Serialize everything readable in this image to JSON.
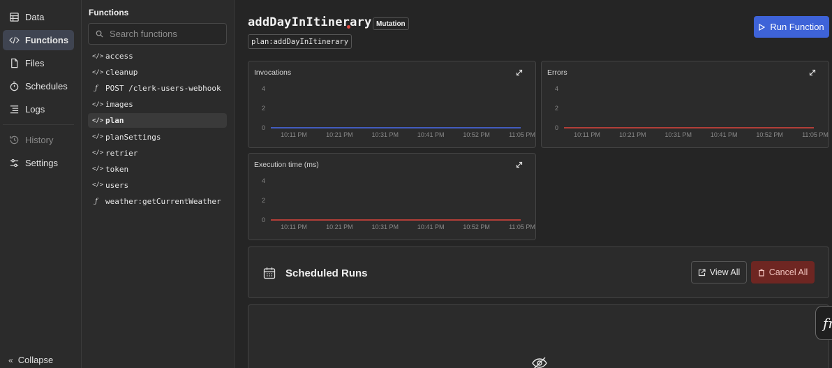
{
  "nav": {
    "items": [
      {
        "label": "Data",
        "icon": "table-icon"
      },
      {
        "label": "Functions",
        "icon": "code-icon",
        "active": true
      },
      {
        "label": "Files",
        "icon": "file-icon"
      },
      {
        "label": "Schedules",
        "icon": "stopwatch-icon"
      },
      {
        "label": "Logs",
        "icon": "list-icon"
      },
      {
        "label": "History",
        "icon": "history-icon",
        "disabled": true
      },
      {
        "label": "Settings",
        "icon": "sliders-icon"
      }
    ],
    "collapse_label": "Collapse"
  },
  "functions_panel": {
    "title": "Functions",
    "search_placeholder": "Search functions",
    "items": [
      {
        "label": "access",
        "icon": "code-icon"
      },
      {
        "label": "cleanup",
        "icon": "code-icon"
      },
      {
        "label": "POST /clerk-users-webhook",
        "icon": "fn-icon"
      },
      {
        "label": "images",
        "icon": "code-icon"
      },
      {
        "label": "plan",
        "icon": "code-icon",
        "active": true
      },
      {
        "label": "planSettings",
        "icon": "code-icon"
      },
      {
        "label": "retrier",
        "icon": "code-icon"
      },
      {
        "label": "token",
        "icon": "code-icon"
      },
      {
        "label": "users",
        "icon": "code-icon"
      },
      {
        "label": "weather:getCurrentWeather",
        "icon": "fn-icon"
      }
    ]
  },
  "function": {
    "name": "addDayInItinerary",
    "type_badge": "Mutation",
    "path": "plan:addDayInItinerary",
    "run_label": "Run Function"
  },
  "colors": {
    "accent": "#3e63d8",
    "invocations_line": "#4a6cf0",
    "errors_line": "#e0453d",
    "execution_line": "#e0453d",
    "danger_bg": "#6e2622"
  },
  "chart_data": [
    {
      "type": "line",
      "title": "Invocations",
      "x": [
        "10:11 PM",
        "10:21 PM",
        "10:31 PM",
        "10:41 PM",
        "10:52 PM",
        "11:05 PM"
      ],
      "series": [
        {
          "values": [
            0,
            0,
            0,
            0,
            0,
            0
          ]
        }
      ],
      "yticks": [
        0,
        2,
        4
      ],
      "ylim": [
        0,
        4
      ],
      "grid": false
    },
    {
      "type": "line",
      "title": "Errors",
      "x": [
        "10:11 PM",
        "10:21 PM",
        "10:31 PM",
        "10:41 PM",
        "10:52 PM",
        "11:05 PM"
      ],
      "series": [
        {
          "values": [
            0,
            0,
            0,
            0,
            0,
            0
          ]
        }
      ],
      "yticks": [
        0,
        2,
        4
      ],
      "ylim": [
        0,
        4
      ],
      "grid": false
    },
    {
      "type": "line",
      "title": "Execution time (ms)",
      "x": [
        "10:11 PM",
        "10:21 PM",
        "10:31 PM",
        "10:41 PM",
        "10:52 PM",
        "11:05 PM"
      ],
      "series": [
        {
          "values": [
            0,
            0,
            0,
            0,
            0,
            0
          ]
        }
      ],
      "yticks": [
        0,
        2,
        4
      ],
      "ylim": [
        0,
        4
      ],
      "grid": false
    }
  ],
  "scheduled_runs": {
    "title": "Scheduled Runs",
    "view_all_label": "View All",
    "cancel_all_label": "Cancel All"
  },
  "fab": {
    "label": "fn"
  }
}
